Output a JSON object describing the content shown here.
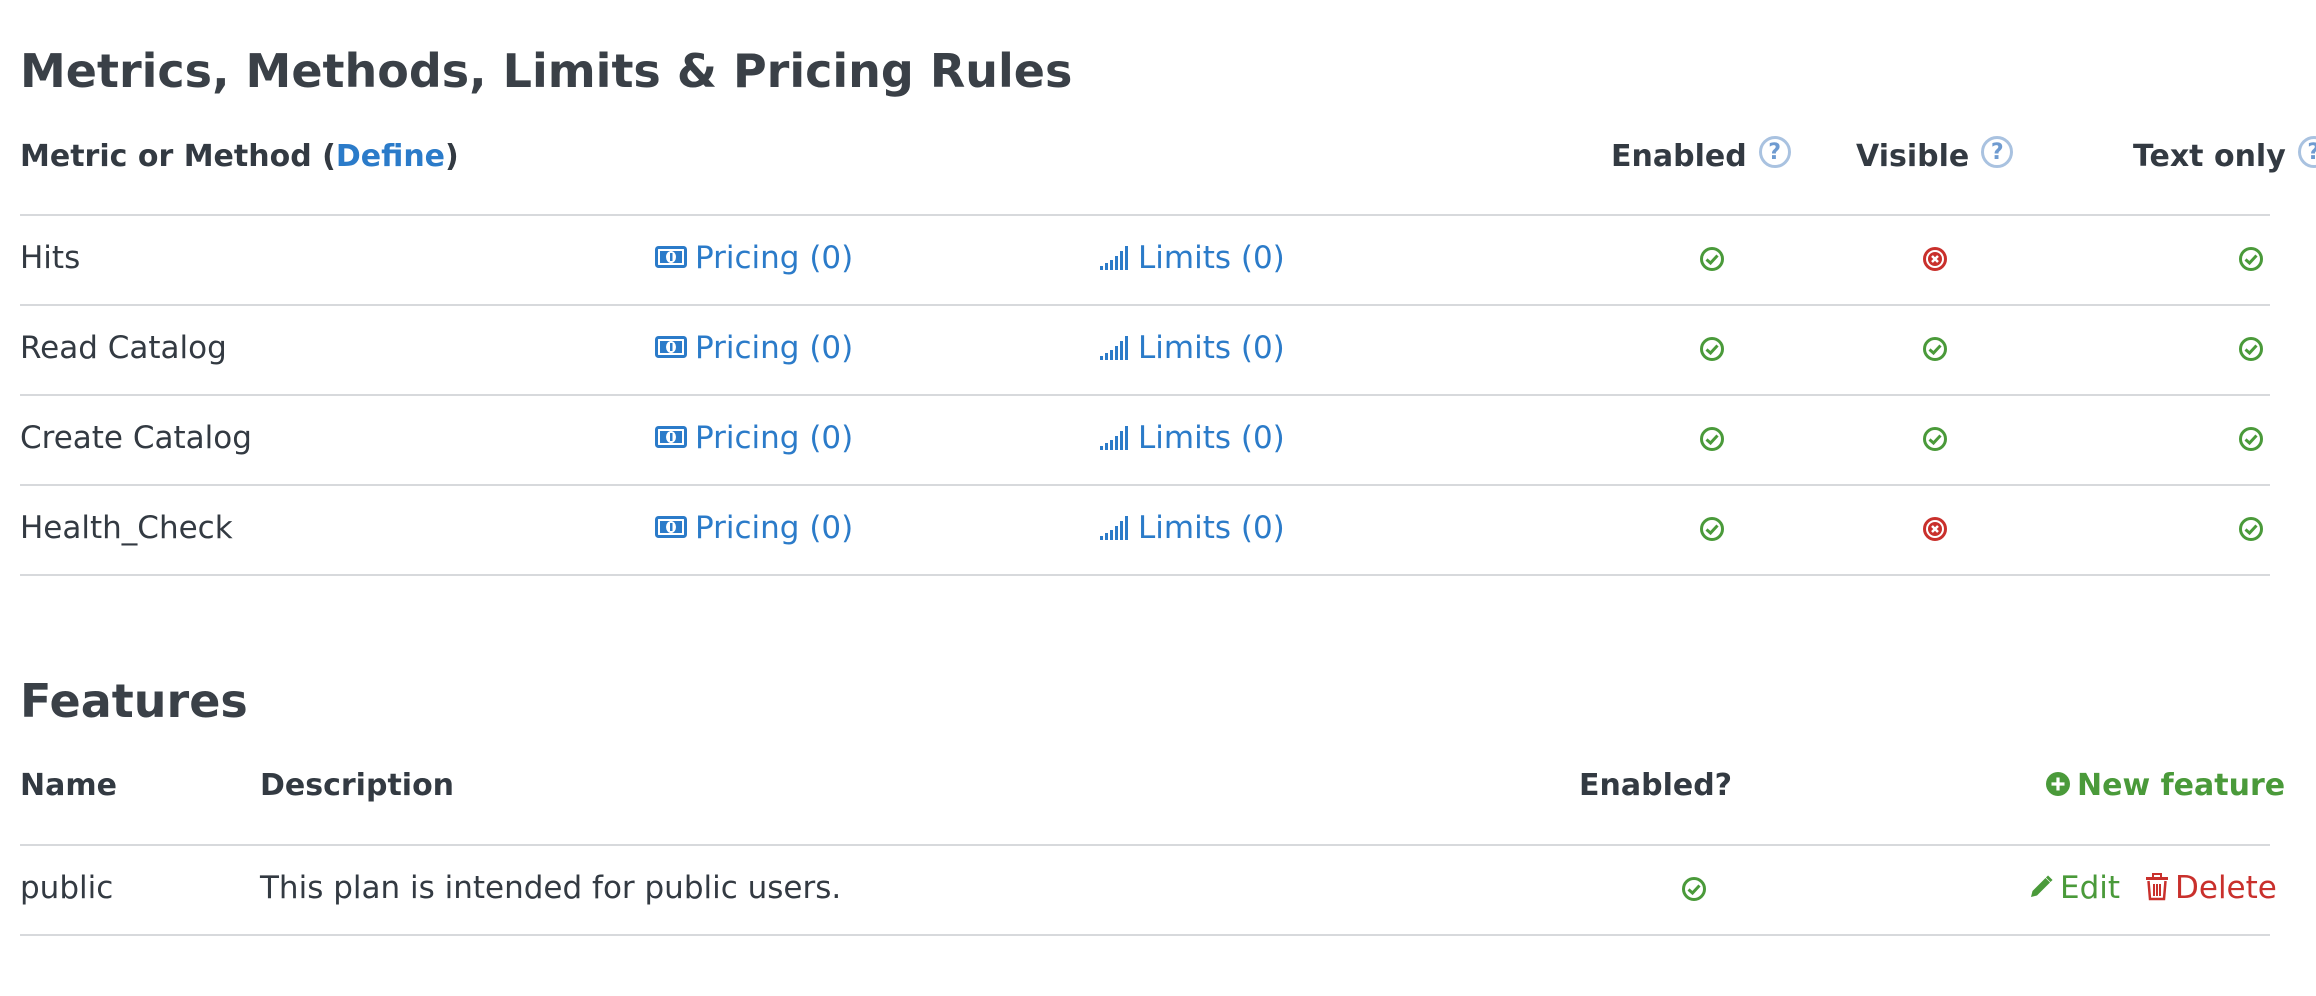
{
  "metrics_section": {
    "title": "Metrics, Methods, Limits & Pricing Rules",
    "header": {
      "metric_prefix": "Metric or Method (",
      "define_link": "Define",
      "metric_suffix": ")",
      "enabled": "Enabled",
      "visible": "Visible",
      "text_only": "Text only",
      "help_glyph": "?"
    },
    "rows": [
      {
        "name": "Hits",
        "pricing": "Pricing (0)",
        "limits": "Limits (0)",
        "enabled": true,
        "visible": false,
        "text_only": true
      },
      {
        "name": "Read Catalog",
        "pricing": "Pricing (0)",
        "limits": "Limits (0)",
        "enabled": true,
        "visible": true,
        "text_only": true
      },
      {
        "name": "Create Catalog",
        "pricing": "Pricing (0)",
        "limits": "Limits (0)",
        "enabled": true,
        "visible": true,
        "text_only": true
      },
      {
        "name": "Health_Check",
        "pricing": "Pricing (0)",
        "limits": "Limits (0)",
        "enabled": true,
        "visible": false,
        "text_only": true
      }
    ]
  },
  "features_section": {
    "title": "Features",
    "header": {
      "name": "Name",
      "description": "Description",
      "enabled": "Enabled?",
      "new_feature": "New feature"
    },
    "rows": [
      {
        "name": "public",
        "description": "This plan is intended for public users.",
        "enabled": true,
        "edit": "Edit",
        "delete": "Delete"
      }
    ]
  },
  "icons": {
    "pricing": "money-icon",
    "limits": "signal-bars-icon",
    "check": "check-circle-icon",
    "cross": "cross-circle-icon",
    "help": "question-circle-icon",
    "new": "plus-circle-icon",
    "edit": "pencil-icon",
    "delete": "trash-icon"
  },
  "colors": {
    "link_blue": "#2b7bc9",
    "success_green": "#4a9a3a",
    "danger_red": "#c9302c",
    "divider": "#d7d9dc"
  }
}
